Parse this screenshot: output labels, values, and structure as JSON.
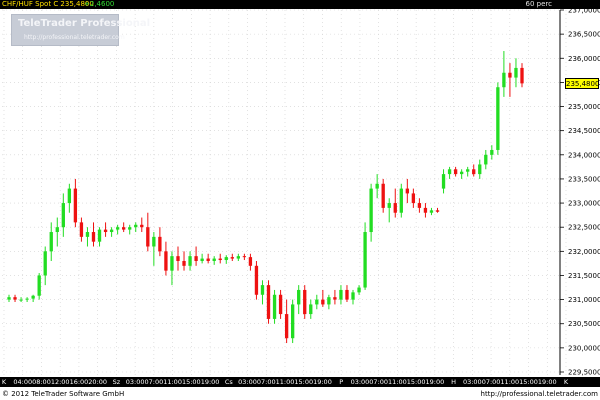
{
  "header": {
    "symbol": "CHF/HUF Spot  C  235,4800",
    "change": "+2,4600",
    "period": "60 perc"
  },
  "watermark": {
    "title": "TeleTrader Professional",
    "url": "http://professional.teletrader.com"
  },
  "footer": {
    "copyright": "© 2012 TeleTrader Software GmbH",
    "url": "http://professional.teletrader.com"
  },
  "colors": {
    "up": "#22dd22",
    "down": "#ee1111",
    "grid": "#d0d0d0",
    "axis_bg": "#000000",
    "last_price_bg": "#ffff00"
  },
  "chart_data": {
    "type": "candlestick",
    "title": "CHF/HUF Spot",
    "last_price": 235.48,
    "last_price_label": "235,4800",
    "ylim": [
      229.5,
      237.0
    ],
    "y_ticks": [
      {
        "v": 229.5,
        "label": "229,5000"
      },
      {
        "v": 230.0,
        "label": "230,0000"
      },
      {
        "v": 230.5,
        "label": "230,5000"
      },
      {
        "v": 231.0,
        "label": "231,0000"
      },
      {
        "v": 231.5,
        "label": "231,5000"
      },
      {
        "v": 232.0,
        "label": "232,0000"
      },
      {
        "v": 232.5,
        "label": "232,5000"
      },
      {
        "v": 233.0,
        "label": "233,0000"
      },
      {
        "v": 233.5,
        "label": "233,5000"
      },
      {
        "v": 234.0,
        "label": "234,0000"
      },
      {
        "v": 234.5,
        "label": "234,5000"
      },
      {
        "v": 235.0,
        "label": "235,0000"
      },
      {
        "v": 235.5,
        "label": "235,5000"
      },
      {
        "v": 236.0,
        "label": "236,0000"
      },
      {
        "v": 236.5,
        "label": "236,5000"
      },
      {
        "v": 237.0,
        "label": "237,0000"
      }
    ],
    "x_labels": [
      "K",
      "04:00",
      "08:00",
      "12:00",
      "16:00",
      "20:00",
      "Sz",
      "03:00",
      "07:00",
      "11:00",
      "15:00",
      "19:00",
      "Cs",
      "03:00",
      "07:00",
      "11:00",
      "15:00",
      "19:00",
      "P",
      "03:00",
      "07:00",
      "11:00",
      "15:00",
      "19:00",
      "H",
      "03:00",
      "07:00",
      "11:00",
      "15:00",
      "19:00",
      "K"
    ],
    "candles": [
      [
        231.0,
        231.1,
        230.95,
        231.05
      ],
      [
        231.05,
        231.1,
        230.95,
        231.0
      ],
      [
        231.0,
        231.05,
        230.95,
        231.0
      ],
      [
        231.0,
        231.05,
        230.95,
        231.02
      ],
      [
        231.02,
        231.1,
        230.95,
        231.08
      ],
      [
        231.08,
        231.55,
        231.0,
        231.5
      ],
      [
        231.5,
        232.1,
        231.3,
        232.0
      ],
      [
        232.0,
        232.6,
        231.8,
        232.4
      ],
      [
        232.4,
        232.7,
        232.1,
        232.5
      ],
      [
        232.5,
        233.2,
        232.3,
        233.0
      ],
      [
        233.0,
        233.4,
        232.8,
        233.3
      ],
      [
        233.3,
        233.5,
        232.5,
        232.6
      ],
      [
        232.6,
        232.7,
        232.2,
        232.3
      ],
      [
        232.3,
        232.5,
        232.1,
        232.4
      ],
      [
        232.4,
        232.6,
        232.1,
        232.2
      ],
      [
        232.2,
        232.5,
        232.1,
        232.45
      ],
      [
        232.45,
        232.6,
        232.3,
        232.4
      ],
      [
        232.4,
        232.5,
        232.3,
        232.45
      ],
      [
        232.45,
        232.55,
        232.35,
        232.5
      ],
      [
        232.5,
        232.6,
        232.4,
        232.45
      ],
      [
        232.45,
        232.55,
        232.35,
        232.5
      ],
      [
        232.5,
        232.6,
        232.4,
        232.55
      ],
      [
        232.55,
        232.7,
        232.4,
        232.5
      ],
      [
        232.5,
        232.8,
        232.0,
        232.1
      ],
      [
        232.1,
        232.4,
        231.7,
        232.3
      ],
      [
        232.3,
        232.5,
        231.9,
        232.0
      ],
      [
        232.0,
        232.2,
        231.5,
        231.6
      ],
      [
        231.6,
        232.0,
        231.3,
        231.9
      ],
      [
        231.9,
        232.1,
        231.6,
        231.8
      ],
      [
        231.8,
        232.0,
        231.6,
        231.7
      ],
      [
        231.7,
        232.0,
        231.6,
        231.9
      ],
      [
        231.9,
        232.1,
        231.7,
        231.8
      ],
      [
        231.8,
        231.95,
        231.75,
        231.85
      ],
      [
        231.85,
        231.95,
        231.75,
        231.8
      ],
      [
        231.8,
        231.9,
        231.72,
        231.85
      ],
      [
        231.85,
        231.95,
        231.75,
        231.82
      ],
      [
        231.82,
        231.92,
        231.74,
        231.88
      ],
      [
        231.88,
        231.95,
        231.8,
        231.85
      ],
      [
        231.85,
        231.95,
        231.8,
        231.9
      ],
      [
        231.9,
        231.95,
        231.82,
        231.88
      ],
      [
        231.88,
        231.95,
        231.6,
        231.7
      ],
      [
        231.7,
        231.8,
        231.0,
        231.1
      ],
      [
        231.1,
        231.4,
        230.9,
        231.3
      ],
      [
        231.3,
        231.4,
        230.5,
        230.6
      ],
      [
        230.6,
        231.2,
        230.5,
        231.1
      ],
      [
        231.1,
        231.2,
        230.6,
        230.7
      ],
      [
        230.7,
        231.0,
        230.1,
        230.2
      ],
      [
        230.2,
        231.0,
        230.1,
        230.9
      ],
      [
        230.9,
        231.3,
        230.7,
        231.2
      ],
      [
        231.2,
        231.3,
        230.6,
        230.7
      ],
      [
        230.7,
        231.0,
        230.6,
        230.9
      ],
      [
        230.9,
        231.1,
        230.8,
        231.0
      ],
      [
        231.0,
        231.2,
        230.85,
        230.9
      ],
      [
        230.9,
        231.1,
        230.8,
        231.05
      ],
      [
        231.05,
        231.2,
        230.9,
        231.0
      ],
      [
        231.0,
        231.3,
        230.9,
        231.2
      ],
      [
        231.2,
        231.3,
        230.95,
        231.0
      ],
      [
        231.0,
        231.2,
        230.9,
        231.15
      ],
      [
        231.15,
        231.3,
        231.1,
        231.25
      ],
      [
        231.25,
        232.6,
        231.2,
        232.4
      ],
      [
        232.4,
        233.4,
        232.2,
        233.3
      ],
      [
        233.3,
        233.6,
        233.1,
        233.4
      ],
      [
        233.4,
        233.5,
        232.8,
        232.9
      ],
      [
        232.9,
        233.1,
        232.6,
        233.0
      ],
      [
        233.0,
        233.3,
        232.7,
        232.8
      ],
      [
        232.8,
        233.4,
        232.7,
        233.3
      ],
      [
        233.3,
        233.5,
        233.0,
        233.2
      ],
      [
        233.2,
        233.3,
        232.9,
        233.0
      ],
      [
        233.0,
        233.1,
        232.8,
        232.9
      ],
      [
        232.9,
        233.0,
        232.7,
        232.8
      ],
      [
        232.8,
        232.9,
        232.75,
        232.85
      ],
      [
        232.85,
        232.9,
        232.8,
        232.82
      ],
      [
        233.3,
        233.7,
        233.2,
        233.6
      ],
      [
        233.6,
        233.75,
        233.5,
        233.7
      ],
      [
        233.7,
        233.75,
        233.55,
        233.6
      ],
      [
        233.6,
        233.7,
        233.5,
        233.65
      ],
      [
        233.65,
        233.75,
        233.55,
        233.7
      ],
      [
        233.7,
        233.8,
        233.55,
        233.6
      ],
      [
        233.6,
        233.9,
        233.5,
        233.8
      ],
      [
        233.8,
        234.1,
        233.7,
        234.0
      ],
      [
        234.0,
        234.2,
        233.9,
        234.1
      ],
      [
        234.1,
        235.5,
        234.0,
        235.4
      ],
      [
        235.4,
        236.15,
        235.2,
        235.7
      ],
      [
        235.7,
        235.9,
        235.2,
        235.6
      ],
      [
        235.6,
        236.0,
        235.4,
        235.8
      ],
      [
        235.8,
        235.9,
        235.4,
        235.48
      ]
    ]
  }
}
